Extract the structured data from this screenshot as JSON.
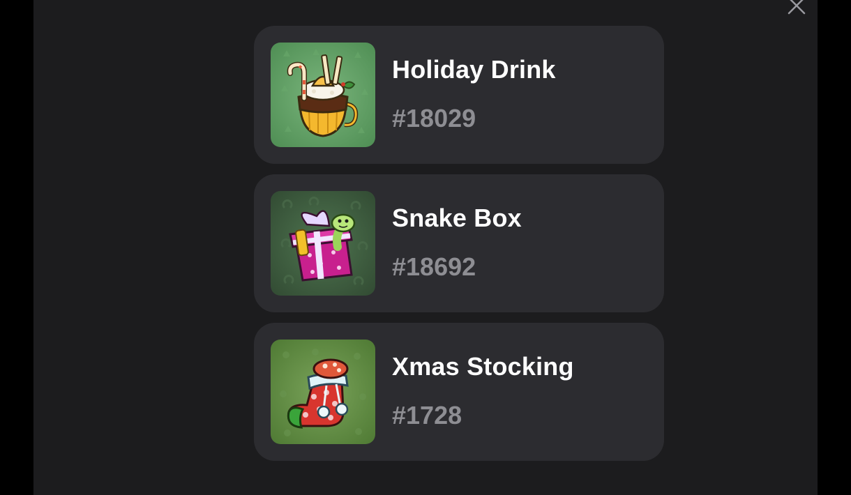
{
  "modal": {
    "close_icon": "close-icon",
    "items": [
      {
        "title": "Holiday Drink",
        "number": "#18029",
        "icon": "holiday-drink-icon",
        "bg": "#5e9e62"
      },
      {
        "title": "Snake Box",
        "number": "#18692",
        "icon": "snake-box-icon",
        "bg": "#3f5e3f"
      },
      {
        "title": "Xmas Stocking",
        "number": "#1728",
        "icon": "xmas-stocking-icon",
        "bg": "#628c44"
      }
    ]
  },
  "colors": {
    "page_bg": "#000000",
    "modal_bg": "#1c1c1e",
    "card_bg": "#2c2c30",
    "title": "#ffffff",
    "number": "#8e8e93"
  }
}
